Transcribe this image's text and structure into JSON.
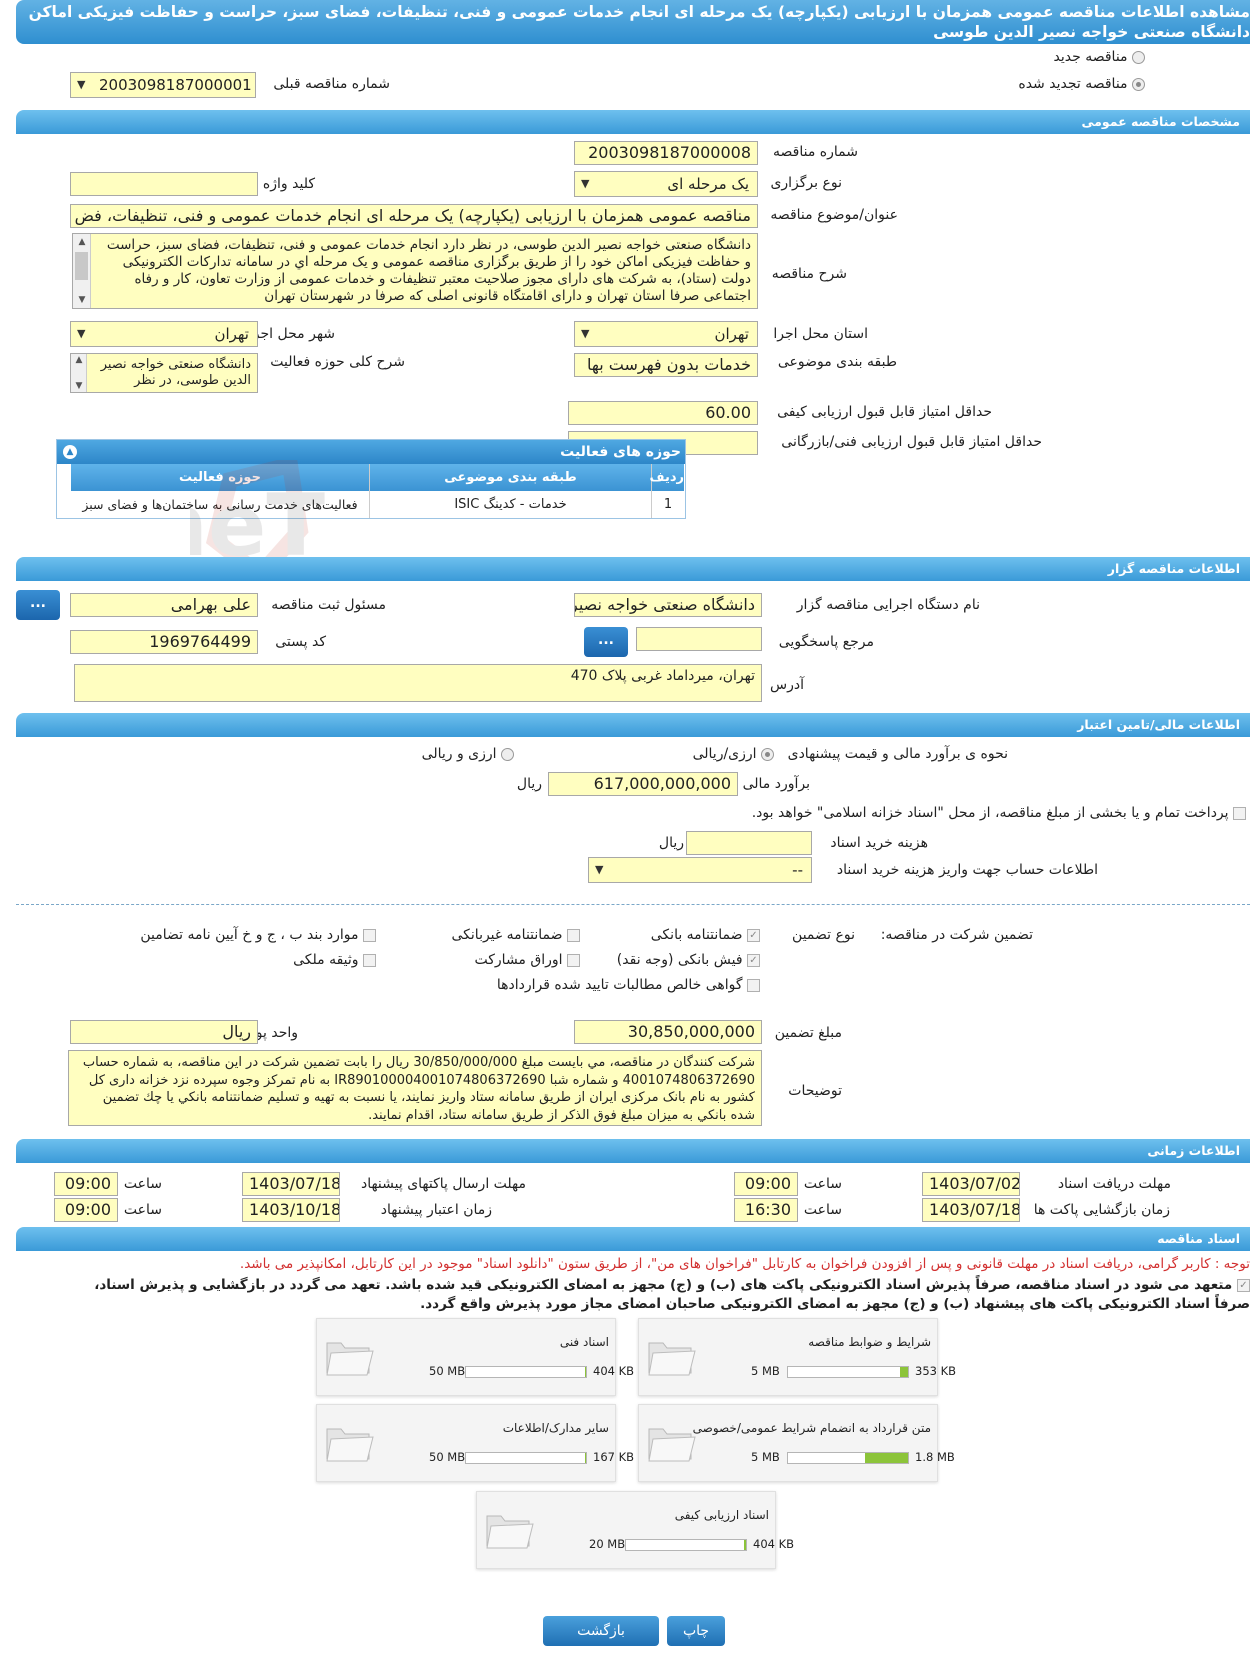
{
  "title": "مشاهده اطلاعات مناقصه عمومی همزمان با ارزیابی (یکپارچه) یک مرحله ای انجام خدمات عمومی و فنی، تنظیفات، فضای سبز، حراست و حفاظت فیزیکی اماکن دانشگاه صنعتی خواجه نصیر الدین طوسی",
  "tender_kind": {
    "new_label": "مناقصه جدید",
    "renewed_label": "مناقصه تجدید شده",
    "prev_number_label": "شماره مناقصه قبلی",
    "prev_number": "2003098187000001"
  },
  "general": {
    "section_title": "مشخصات مناقصه عمومی",
    "number_label": "شماره مناقصه",
    "number": "2003098187000008",
    "type_label": "نوع برگزاری",
    "type": "یک مرحله ای",
    "keyword_label": "کلید واژه",
    "keyword": "",
    "subject_label": "عنوان/موضوع مناقصه",
    "subject": "مناقصه عمومی همزمان با ارزیابی (یکپارچه) یک مرحله ای انجام خدمات عمومی و فنی، تنظیفات، فض",
    "desc_label": "شرح مناقصه",
    "desc": "دانشگاه صنعتی خواجه نصیر الدین طوسی، در نظر دارد انجام خدمات عمومی و فنی، تنظیفات، فضای سبز، حراست و حفاظت فیزیکی اماکن خود را از طریق برگزاری مناقصه عمومی و یک مرحله اي در سامانه تدارکات الکترونیکی دولت (ستاد)، به شرکت های دارای مجوز صلاحیت معتبر تنظیفات و خدمات عمومی از وزارت تعاون، کار و رفاه اجتماعی صرفا استان تهران و دارای اقامتگاه قانونی اصلی که صرفا در شهرستان تهران",
    "province_label": "استان محل اجرا",
    "province": "تهران",
    "city_label": "شهر محل اجرا",
    "city": "تهران",
    "category_label": "طبقه بندی موضوعی",
    "category": "خدمات بدون فهرست بها",
    "activity_desc_label": "شرح کلی حوزه فعالیت",
    "activity_desc": "دانشگاه صنعتی خواجه نصیر الدین طوسی، در نظر",
    "min_quality_label": "حداقل امتیاز قابل قبول ارزیابی کیفی",
    "min_quality": "60.00",
    "min_tech_label": "حداقل امتیاز قابل قبول ارزیابی فنی/بازرگانی",
    "min_tech": ""
  },
  "activities": {
    "title": "حوزه های فعالیت",
    "columns": [
      "ردیف",
      "طبقه بندی موضوعی",
      "حوزه فعالیت"
    ],
    "rows": [
      {
        "idx": "1",
        "category": "خدمات - کدینگ ISIC",
        "field": "فعالیت‌های خدمت رسانی به ساختمان‌ها و فضای سبز"
      }
    ]
  },
  "organizer": {
    "section_title": "اطلاعات مناقصه گزار",
    "org_label": "نام دستگاه اجرایی مناقصه گزار",
    "org": "دانشگاه صنعتی خواجه نصیر",
    "registrar_label": "مسئول ثبت مناقصه",
    "registrar": "علی بهرامی",
    "ref_label": "مرجع پاسخگویی",
    "ref": "",
    "postal_label": "کد پستی",
    "postal": "1969764499",
    "address_label": "آدرس",
    "address": "تهران، میرداماد غربی پلاک 470",
    "dots": "..."
  },
  "finance": {
    "section_title": "اطلاعات مالی/تامین اعتبار",
    "mode_label": "نحوه ی برآورد مالی و قیمت پیشنهادی",
    "mode_rial": "ارزی/ریالی",
    "mode_fx": "ارزی و ریالی",
    "estimate_label": "برآورد مالی",
    "estimate": "617,000,000,000",
    "rial": "ریال",
    "treasury_text": "پرداخت تمام و یا بخشی از مبلغ مناقصه، از محل \"اسناد خزانه اسلامی\" خواهد بود.",
    "doc_fee_label": "هزینه خرید اسناد",
    "doc_fee": "",
    "account_label": "اطلاعات حساب جهت واریز هزینه خرید اسناد",
    "account": "--"
  },
  "guarantee": {
    "label": "تضمین شرکت در مناقصه:",
    "type_label": "نوع تضمین",
    "options": [
      {
        "label": "ضمانتنامه بانکی",
        "checked": true
      },
      {
        "label": "ضمانتنامه غیربانکی",
        "checked": false
      },
      {
        "label": "موارد بند ب ، ج و خ آیین نامه تضامین",
        "checked": false
      },
      {
        "label": "فیش بانکی (وجه نقد)",
        "checked": true
      },
      {
        "label": "اوراق مشارکت",
        "checked": false
      },
      {
        "label": "وثیقه ملکی",
        "checked": false
      },
      {
        "label": "گواهی خالص مطالبات تایید شده قراردادها",
        "checked": false
      }
    ],
    "amount_label": "مبلغ تضمین",
    "amount": "30,850,000,000",
    "currency_label": "واحد پول",
    "currency": "ریال",
    "notes_label": "توضیحات",
    "notes": "شرکت کنندگان در مناقصه، مي بايست مبلغ 30/850/000/000 ریال را بابت تضمین شرکت در این مناقصه، به شماره حساب 4001074806372690 و شماره شبا IR890100004001074806372690 به نام تمرکز وجوه سپرده نزد خزانه داری کل کشور به نام بانک مرکزی ایران از طریق سامانه ستاد واریز نمایند، یا نسبت به تهیه و تسلیم ضمانتنامه بانکي یا چك تضمین شده بانکي به میزان مبلغ فوق الذکر از طریق سامانه ستاد، اقدام نمایند."
  },
  "timing": {
    "section_title": "اطلاعات زمانی",
    "doc_receive_label": "مهلت دریافت اسناد",
    "doc_receive_date": "1403/07/02",
    "doc_receive_time": "09:00",
    "send_label": "مهلت ارسال پاکتهای پیشنهاد",
    "send_date": "1403/07/18",
    "send_time": "09:00",
    "open_label": "زمان بازگشایی پاکت ها",
    "open_date": "1403/07/18",
    "open_time": "16:30",
    "valid_label": "زمان اعتبار پیشنهاد",
    "valid_date": "1403/10/18",
    "valid_time": "09:00",
    "time_label": "ساعت"
  },
  "documents": {
    "section_title": "اسناد مناقصه",
    "notice": "توجه : کاربر گرامی، دریافت اسناد در مهلت قانونی و پس از افزودن فراخوان به کارتابل \"فراخوان های من\"، از طریق ستون \"دانلود اسناد\" موجود در این کارتابل، امکانپذیر می باشد.",
    "commit_line1": "متعهد می شود در اسناد مناقصه، صرفاً پذیرش اسناد الکترونیکی پاکت های (ب) و (ج) مجهز به امضای الکترونیکی قید شده باشد. تعهد می گردد در بازگشایی و پذیرش اسناد،",
    "commit_line2": "صرفاً اسناد الکترونیکی پاکت های پیشنهاد (ب) و (ج) مجهز به امضای الکترونیکی صاحبان امضای مجاز مورد پذیرش واقع گردد.",
    "files": [
      {
        "title": "شرایط و ضوابط مناقصه",
        "size": "353 KB",
        "max": "5 MB",
        "fraction": 0.07
      },
      {
        "title": "اسناد فنی",
        "size": "404 KB",
        "max": "50 MB",
        "fraction": 0.01
      },
      {
        "title": "متن قرارداد به انضمام شرایط عمومی/خصوصی",
        "size": "1.8 MB",
        "max": "5 MB",
        "fraction": 0.36
      },
      {
        "title": "سایر مدارک/اطلاعات",
        "size": "167 KB",
        "max": "50 MB",
        "fraction": 0.005
      },
      {
        "title": "اسناد ارزیابی کیفی",
        "size": "404 KB",
        "max": "20 MB",
        "fraction": 0.02
      }
    ]
  },
  "buttons": {
    "back": "بازگشت",
    "print": "چاپ"
  },
  "watermark": "AriaTender.neT"
}
